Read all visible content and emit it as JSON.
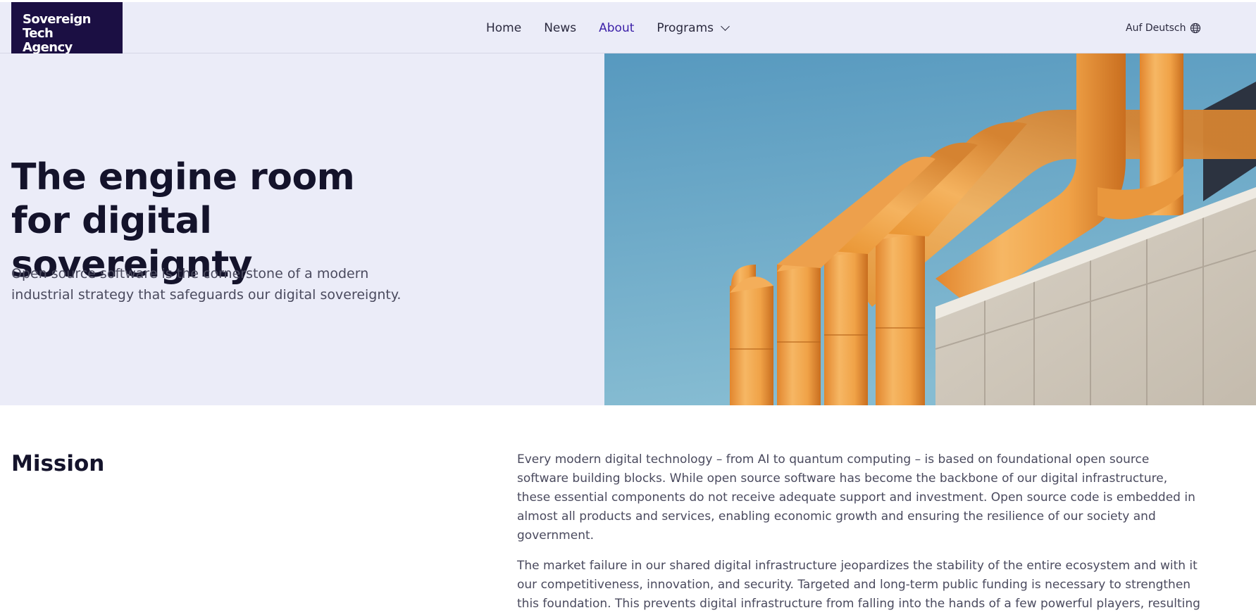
{
  "header": {
    "logo_line1": "Sovereign Tech",
    "logo_line2": "Agency",
    "nav": [
      {
        "label": "Home"
      },
      {
        "label": "News"
      },
      {
        "label": "About"
      },
      {
        "label": "Programs"
      }
    ],
    "language_switch": "Auf Deutsch",
    "language_icon": "globe-icon"
  },
  "hero": {
    "title": "The engine room for digital sovereignty",
    "lead": "Open source software is the cornerstone of a modern industrial strategy that safeguards our digital sovereignty."
  },
  "mission": {
    "heading": "Mission",
    "paragraphs": [
      "Every modern digital technology – from AI to quantum computing – is based on foundational open source software building blocks. While open source software has become the backbone of our digital infrastructure, these essential components do not receive adequate support and investment. Open source code is embedded in almost all products and services, enabling economic growth and ensuring the resilience of our society and government.",
      "The market failure in our shared digital infrastructure jeopardizes the stability of the entire ecosystem and with it our competitiveness, innovation, and security. Targeted and long-term public funding is necessary to strengthen this foundation. This prevents digital infrastructure from falling into the hands of a few powerful players, resulting in a one-sided, destabilizing dependencies."
    ]
  },
  "colors": {
    "brand_dark": "#1b0f43",
    "accent_active": "#3b1fa8",
    "hero_bg": "#ebecf8"
  }
}
